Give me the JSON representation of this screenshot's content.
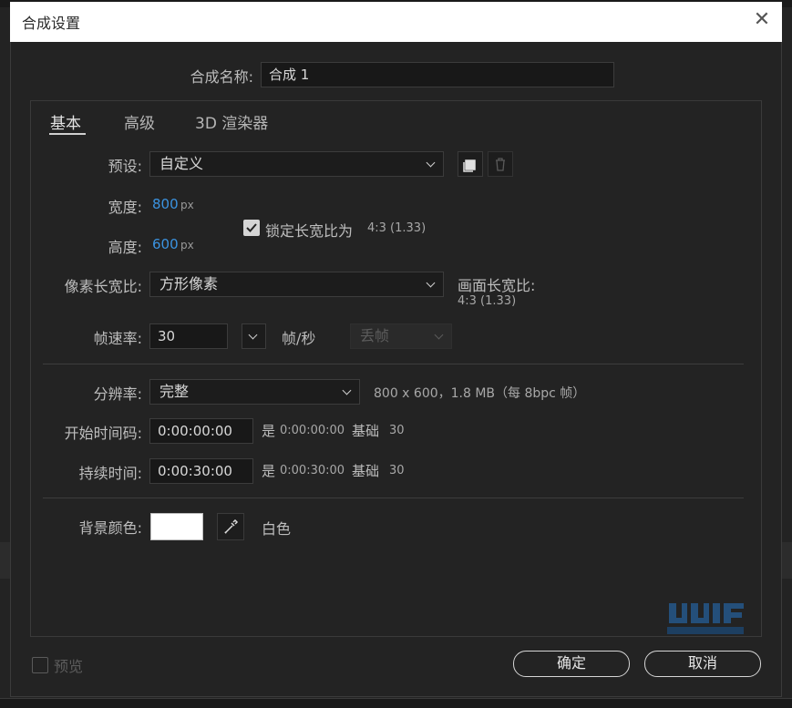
{
  "dialog": {
    "title": "合成设置"
  },
  "composition": {
    "name_label": "合成名称:",
    "name_value": "合成 1"
  },
  "tabs": [
    {
      "label": "基本",
      "active": true
    },
    {
      "label": "高级",
      "active": false
    },
    {
      "label": "3D 渲染器",
      "active": false
    }
  ],
  "basic": {
    "preset_label": "预设:",
    "preset_value": "自定义",
    "width_label": "宽度:",
    "width_value": "800",
    "height_label": "高度:",
    "height_value": "600",
    "px_unit": "px",
    "lock_label": "锁定长宽比为",
    "lock_ratio": "4:3 (1.33)",
    "lock_checked": true,
    "pixel_aspect_label": "像素长宽比:",
    "pixel_aspect_value": "方形像素",
    "frame_aspect_label": "画面长宽比:",
    "frame_aspect_value": "4:3 (1.33)",
    "fps_label": "帧速率:",
    "fps_value": "30",
    "fps_unit": "帧/秒",
    "drop_frame_value": "丢帧",
    "resolution_label": "分辨率:",
    "resolution_value": "完整",
    "resolution_info": "800 x 600，1.8 MB（每 8bpc 帧）",
    "start_tc_label": "开始时间码:",
    "start_tc_value": "0:00:00:00",
    "start_tc_is": "是",
    "start_tc_info": "0:00:00:00",
    "start_tc_base_label": "基础",
    "start_tc_base": "30",
    "duration_label": "持续时间:",
    "duration_value": "0:00:30:00",
    "duration_is": "是",
    "duration_info": "0:00:30:00",
    "duration_base_label": "基础",
    "duration_base": "30",
    "bg_color_label": "背景颜色:",
    "bg_color_name": "白色",
    "bg_color": "#ffffff"
  },
  "footer": {
    "preview_label": "预览",
    "preview_checked": false,
    "ok_label": "确定",
    "cancel_label": "取消"
  },
  "icons": {
    "preset_save": "save-preset-icon",
    "preset_delete": "trash-icon",
    "eyedropper": "eyedropper-icon",
    "close": "close-icon"
  },
  "colors": {
    "accent_value": "#3b93e0",
    "background": "#232323"
  }
}
